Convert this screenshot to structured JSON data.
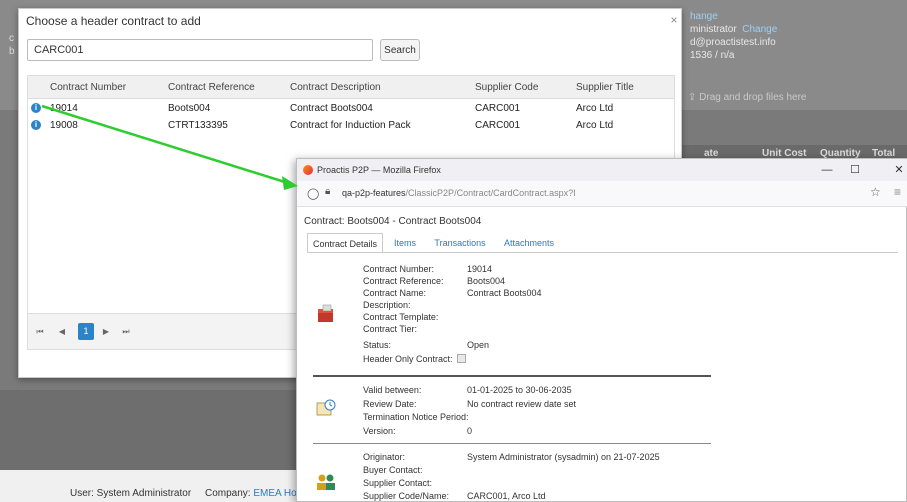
{
  "background": {
    "right_info": [
      "hange",
      "ministrator",
      "Change",
      "d@proactistest.info",
      "1536  /  n/a"
    ],
    "dropzone": "Drag and drop files here",
    "table_head": [
      "ate",
      "Unit Cost",
      "Quantity",
      "Total Cost"
    ],
    "left_letters": [
      "c",
      "b"
    ],
    "footer_user": "User: System Administrator",
    "footer_company_label": "Company:",
    "footer_company_value": "EMEA Ho"
  },
  "modal": {
    "title": "Choose a header contract to add",
    "close_glyph": "×",
    "search_value": "CARC001",
    "search_button": "Search",
    "columns": [
      "Contract Number",
      "Contract Reference",
      "Contract Description",
      "Supplier Code",
      "Supplier Title"
    ],
    "rows": [
      {
        "number": "19014",
        "reference": "Boots004",
        "description": "Contract Boots004",
        "supplier_code": "CARC001",
        "supplier_title": "Arco Ltd"
      },
      {
        "number": "19008",
        "reference": "CTRT133395",
        "description": "Contract for Induction Pack",
        "supplier_code": "CARC001",
        "supplier_title": "Arco Ltd"
      }
    ],
    "pager": {
      "first": "⏮",
      "prev": "◀",
      "current": "1",
      "next": "▶",
      "last": "⏭"
    }
  },
  "browser": {
    "title": "Proactis P2P — Mozilla Firefox",
    "minimize": "—",
    "maximize": "☐",
    "close": "✕",
    "url_host": "qa-p2p-features",
    "url_path": "/ClassicP2P/Contract/CardContract.aspx?I",
    "heading": "Contract: Boots004 - Contract Boots004",
    "tabs": [
      "Contract Details",
      "Items",
      "Transactions",
      "Attachments"
    ],
    "section1": {
      "labels": [
        "Contract Number:",
        "Contract Reference:",
        "Contract Name:",
        "Description:",
        "Contract Template:",
        "Contract Tier:",
        "Status:",
        "Header Only Contract:"
      ],
      "values": [
        "19014",
        "Boots004",
        "Contract Boots004",
        "",
        "",
        "",
        "Open",
        ""
      ]
    },
    "section2": {
      "labels": [
        "Valid between:",
        "Review Date:",
        "Termination Notice Period:",
        "Version:"
      ],
      "values": [
        "01-01-2025 to 30-06-2035",
        "No contract review date set",
        "",
        "0"
      ]
    },
    "section3": {
      "labels": [
        "Originator:",
        "Buyer Contact:",
        "Supplier Contact:",
        "Supplier Code/Name:"
      ],
      "values": [
        "System Administrator (sysadmin) on 21-07-2025",
        "",
        "",
        "CARC001, Arco Ltd"
      ]
    }
  },
  "colors": {
    "accent": "#2b84c8",
    "arrow": "#2ecc2e",
    "link": "#2a7ac0"
  }
}
